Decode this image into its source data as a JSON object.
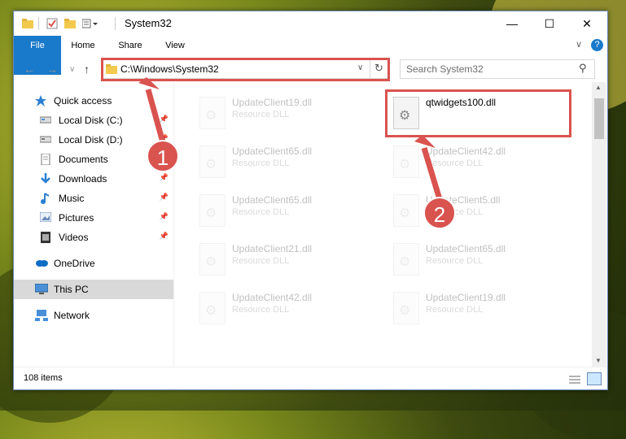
{
  "window": {
    "title": "System32",
    "minimize": "—",
    "maximize": "☐",
    "close": "✕"
  },
  "ribbon": {
    "tabs": [
      "File",
      "Home",
      "Share",
      "View"
    ]
  },
  "navigation": {
    "back": "←",
    "forward": "→",
    "recent": "∨",
    "up": "↑",
    "address": "C:\\Windows\\System32",
    "dropdown": "∨",
    "refresh": "↻",
    "search_placeholder": "Search System32",
    "search_icon": "⚲"
  },
  "sidebar": {
    "items": [
      {
        "label": "Quick access",
        "icon": "star-icon"
      },
      {
        "label": "Local Disk (C:)",
        "icon": "drive-icon"
      },
      {
        "label": "Local Disk (D:)",
        "icon": "drive-icon"
      },
      {
        "label": "Documents",
        "icon": "documents-icon"
      },
      {
        "label": "Downloads",
        "icon": "download-icon"
      },
      {
        "label": "Music",
        "icon": "music-icon"
      },
      {
        "label": "Pictures",
        "icon": "pictures-icon"
      },
      {
        "label": "Videos",
        "icon": "videos-icon"
      },
      {
        "label": "OneDrive",
        "icon": "cloud-icon"
      },
      {
        "label": "This PC",
        "icon": "computer-icon"
      },
      {
        "label": "Network",
        "icon": "network-icon"
      }
    ]
  },
  "files": [
    {
      "name": "UpdateClient19.dll",
      "type": "Resource DLL"
    },
    {
      "name": "qtwidgets100.dll",
      "type": ""
    },
    {
      "name": "UpdateClient65.dll",
      "type": "Resource DLL"
    },
    {
      "name": "UpdateClient42.dll",
      "type": "Resource DLL"
    },
    {
      "name": "UpdateClient65.dll",
      "type": "Resource DLL"
    },
    {
      "name": "UpdateClient5.dll",
      "type": "Resource DLL"
    },
    {
      "name": "UpdateClient21.dll",
      "type": "Resource DLL"
    },
    {
      "name": "UpdateClient65.dll",
      "type": "Resource DLL"
    },
    {
      "name": "UpdateClient42.dll",
      "type": "Resource DLL"
    },
    {
      "name": "UpdateClient19.dll",
      "type": "Resource DLL"
    }
  ],
  "status": {
    "item_count": "108 items"
  },
  "callouts": [
    "1",
    "2"
  ],
  "colors": {
    "accent": "#1979ca",
    "highlight": "#d9534f"
  }
}
